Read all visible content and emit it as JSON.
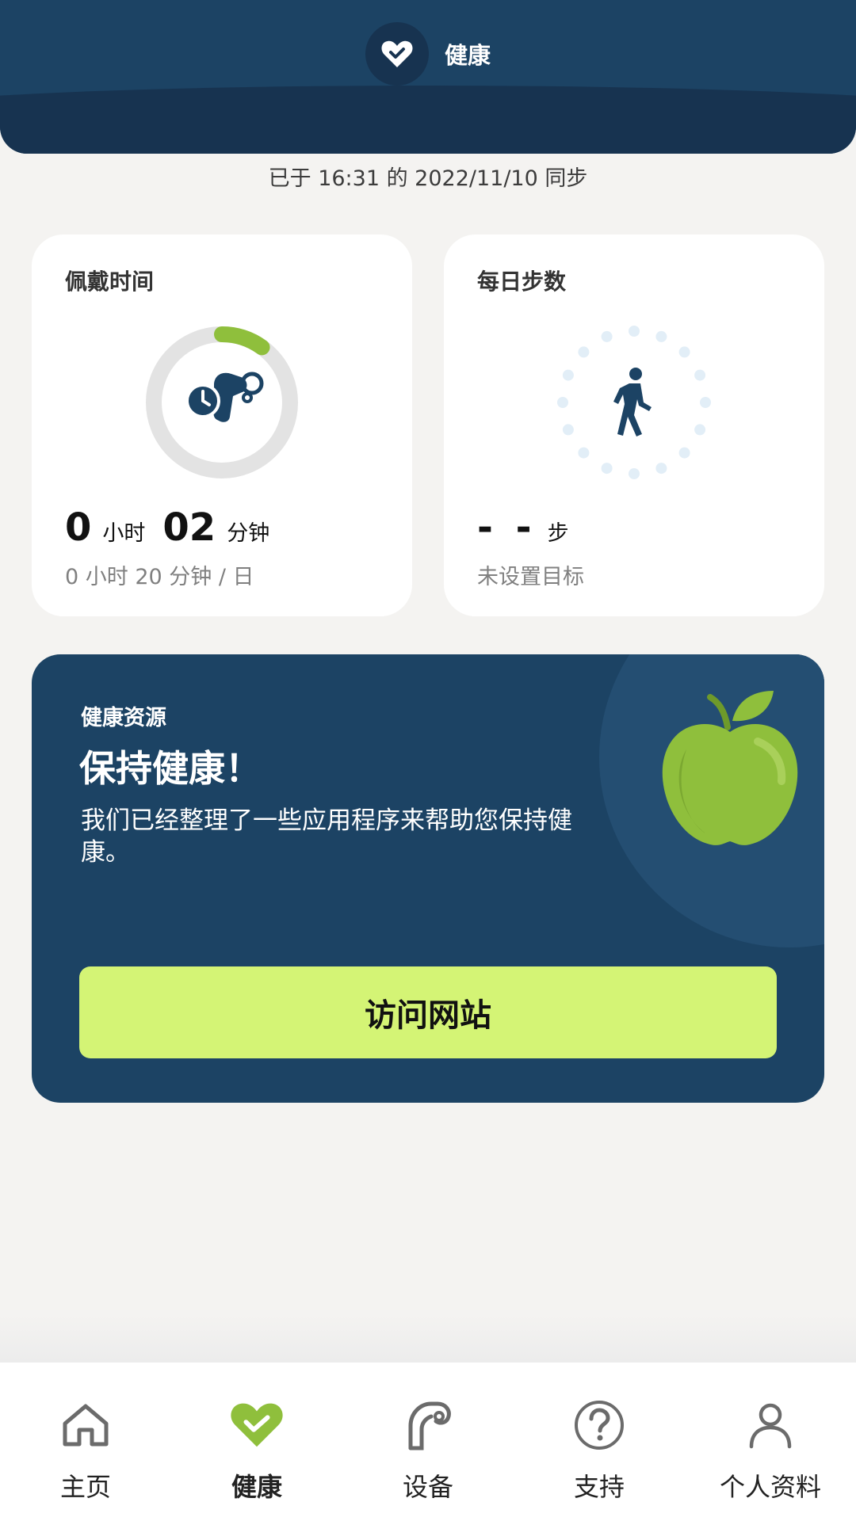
{
  "header": {
    "title": "健康",
    "icon": "heart-icon"
  },
  "sync": {
    "text": "已于 16:31 的 2022/11/10 同步"
  },
  "wear_card": {
    "title": "佩戴时间",
    "icon": "hearing-aid-clock-icon",
    "hours": "0",
    "hours_unit": "小时",
    "minutes": "02",
    "minutes_unit": "分钟",
    "goal": "0 小时 20 分钟 / 日",
    "progress_fraction": 0.1,
    "ring_color": "#8fbf3c",
    "ring_track_color": "#e3e3e3"
  },
  "steps_card": {
    "title": "每日步数",
    "icon": "walking-person-icon",
    "value": "- -",
    "unit": "步",
    "goal": "未设置目标"
  },
  "resources": {
    "label": "健康资源",
    "title": "保持健康！",
    "description": "我们已经整理了一些应用程序来帮助您保持健康。",
    "button_label": "访问网站",
    "icon": "apple-icon",
    "button_color": "#d4f475"
  },
  "nav": {
    "items": [
      {
        "label": "主页",
        "icon": "home-icon",
        "active": false
      },
      {
        "label": "健康",
        "icon": "heart-icon",
        "active": true
      },
      {
        "label": "设备",
        "icon": "hearing-aid-icon",
        "active": false
      },
      {
        "label": "支持",
        "icon": "question-icon",
        "active": false
      },
      {
        "label": "个人资料",
        "icon": "person-icon",
        "active": false
      }
    ]
  },
  "colors": {
    "primary": "#1c4364",
    "accent_green": "#8fbf3c"
  }
}
